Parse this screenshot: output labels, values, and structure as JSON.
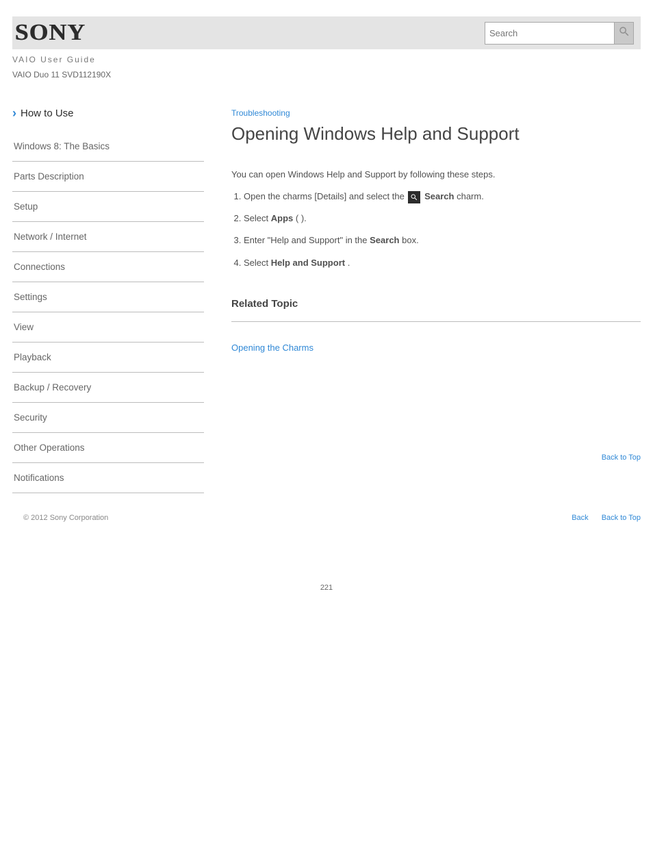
{
  "header": {
    "logo_text": "SONY",
    "subheading": "VAIO User Guide",
    "model": "VAIO Duo 11 SVD112190X",
    "search_placeholder": "Search"
  },
  "sidebar": {
    "how_to_label": "How to Use",
    "items": [
      "Windows 8: The Basics",
      "Parts Description",
      "Setup",
      "Network / Internet",
      "Connections",
      "Settings",
      "View",
      "Playback",
      "Backup / Recovery",
      "Security",
      "Other Operations",
      "Notifications"
    ]
  },
  "main": {
    "breadcrumb": "Troubleshooting",
    "title": "Opening Windows Help and Support",
    "intro": "You can open Windows Help and Support by following these steps.",
    "steps": [
      {
        "pre": "Open the charms [Details] and select the ",
        "strong": "Search",
        "post": " charm."
      },
      {
        "pre": "Select ",
        "strong": "Apps",
        "mid": " (",
        "mid2": ")."
      },
      {
        "pre": "Enter \"Help and Support\" in the ",
        "strong": "Search",
        "post": " box."
      },
      {
        "pre": "Select ",
        "strong": "Help and Support",
        "post": "."
      }
    ],
    "related_heading": "Related Topic",
    "related_topic": "Opening the Charms"
  },
  "footer": {
    "back_top": "Back to Top",
    "copyright": "© 2012 Sony Corporation",
    "links": [
      "Back",
      "Back to Top"
    ]
  },
  "page_number": "221"
}
